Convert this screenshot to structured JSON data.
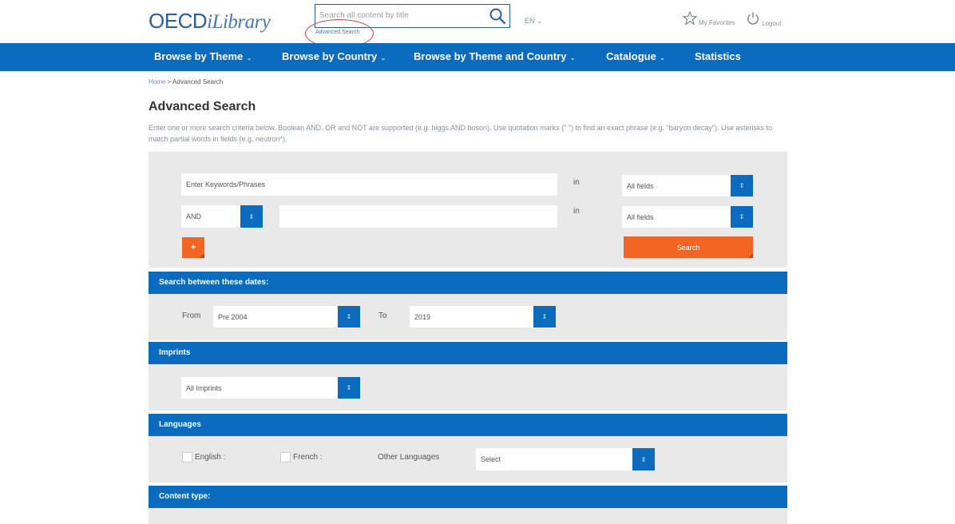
{
  "header": {
    "logo_main": "OECD",
    "logo_script": "iLibrary",
    "search_placeholder": "Search all content by title",
    "advanced_search_link": "Advanced Search",
    "language": "EN ⌄",
    "favorites": "My Favorites",
    "logout": "Logout"
  },
  "nav": {
    "items": [
      {
        "label": "Browse by Theme",
        "chevron": "⌄"
      },
      {
        "label": "Browse by Country",
        "chevron": "⌄"
      },
      {
        "label": "Browse by Theme and Country",
        "chevron": "⌄"
      },
      {
        "label": "Catalogue",
        "chevron": "⌄"
      },
      {
        "label": "Statistics"
      }
    ]
  },
  "breadcrumb": {
    "home": "Home",
    "separator": " > ",
    "current": "Advanced Search"
  },
  "page_title": "Advanced Search",
  "intro": "Enter one or more search criteria below. Boolean AND, OR and NOT are supported (e.g. higgs AND boson). Use quotation marks (\" \") to find an exact phrase (e.g. \"baryon decay\"). Use asterisks to match partial words in fields (e.g. neutron*).",
  "search_form": {
    "keywords_placeholder": "Enter Keywords/Phrases",
    "in_label": "in",
    "field_select": "All fields",
    "operator": "AND",
    "add_button": "+",
    "search_button": "Search"
  },
  "dates": {
    "header": "Search between these dates:",
    "from_label": "From",
    "from_value": "Pre 2004",
    "to_label": "To",
    "to_value": "2019"
  },
  "imprints": {
    "header": "Imprints",
    "value": "All Imprints"
  },
  "languages": {
    "header": "Languages",
    "english": "English :",
    "french": "French :",
    "other_label": "Other Languages",
    "select_placeholder": "Select"
  },
  "content_type": {
    "header": "Content type:"
  },
  "colors": {
    "brand_blue": "#0b6bbf",
    "accent_orange": "#f26522",
    "annotation_red": "#d83a3a"
  }
}
